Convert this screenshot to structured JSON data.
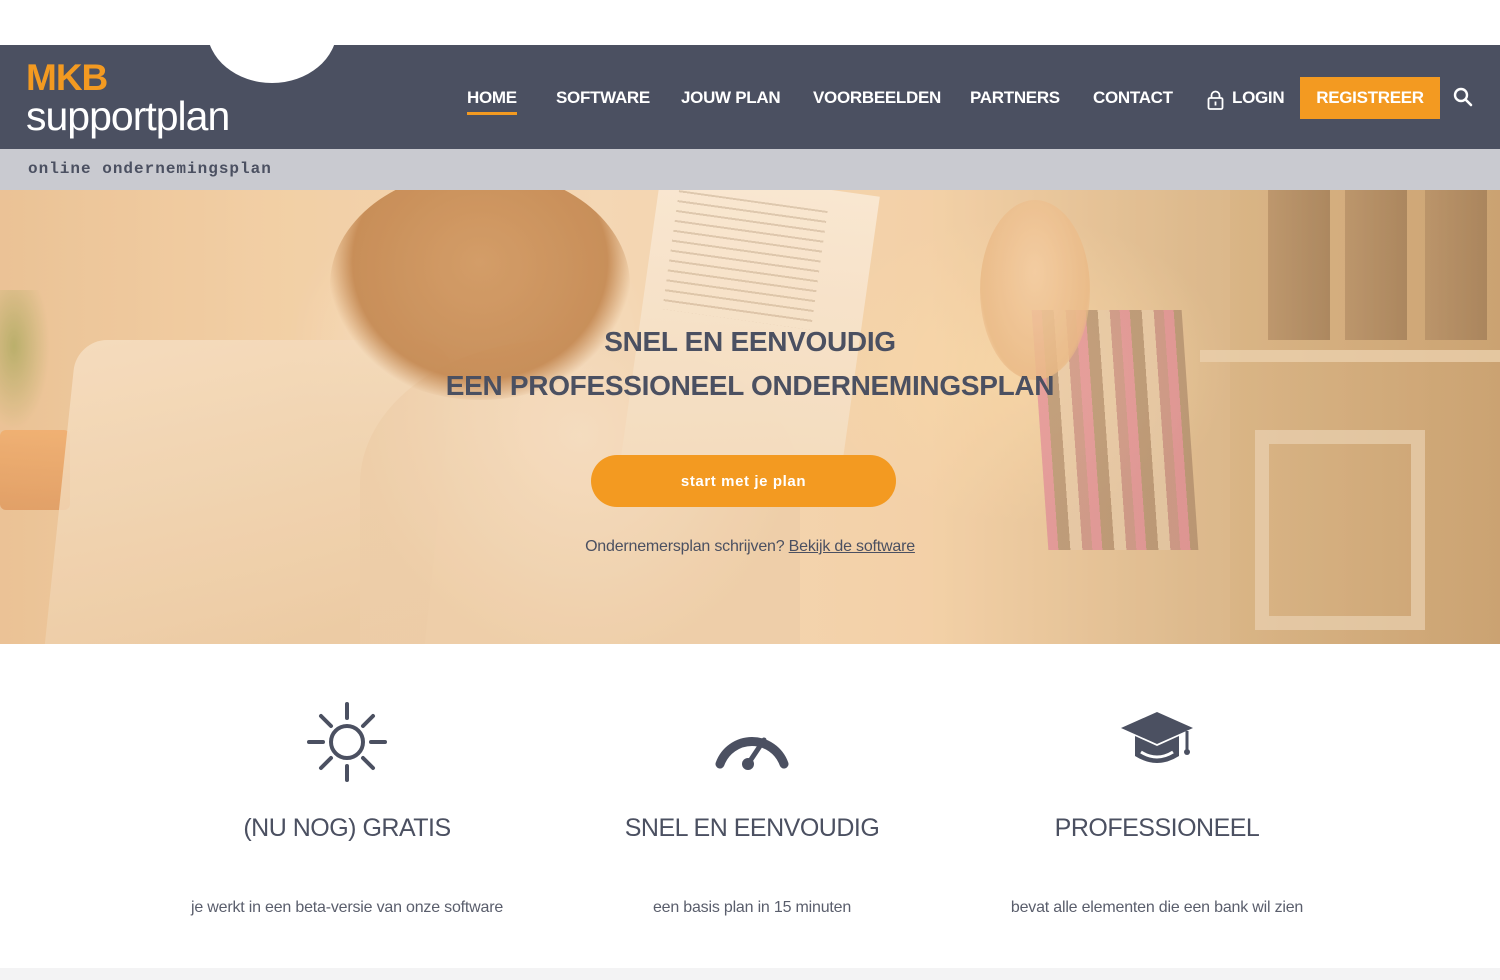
{
  "logo": {
    "mkb": "MKB",
    "name": "supportplan"
  },
  "nav": {
    "items": [
      {
        "label": "HOME",
        "active": true
      },
      {
        "label": "SOFTWARE"
      },
      {
        "label": "JOUW PLAN"
      },
      {
        "label": "VOORBEELDEN"
      },
      {
        "label": "PARTNERS"
      },
      {
        "label": "CONTACT"
      },
      {
        "label": "LOGIN",
        "icon": "lock-icon"
      }
    ],
    "register_label": "REGISTREER",
    "search_icon": "search-icon"
  },
  "tagline": "online ondernemingsplan",
  "hero": {
    "title_line1": "SNEL EN EENVOUDIG",
    "title_line2": "EEN PROFESSIONEEL ONDERNEMINGSPLAN",
    "cta_label": "start met je plan",
    "sub_text": "Ondernemersplan schrijven?",
    "sub_link": "Bekijk de software"
  },
  "features": [
    {
      "icon": "sun-icon",
      "title": "(NU NOG) GRATIS",
      "description": "je werkt in een beta-versie van onze software"
    },
    {
      "icon": "speedometer-icon",
      "title": "SNEL EN EENVOUDIG",
      "description": "een basis plan in 15 minuten"
    },
    {
      "icon": "graduation-cap-icon",
      "title": "PROFESSIONEEL",
      "description": "bevat alle elementen die een bank wil zien"
    }
  ],
  "colors": {
    "header_bg": "#4b5061",
    "accent": "#f39a21",
    "tagbar_bg": "#c9cad0",
    "text": "#4b5061"
  }
}
